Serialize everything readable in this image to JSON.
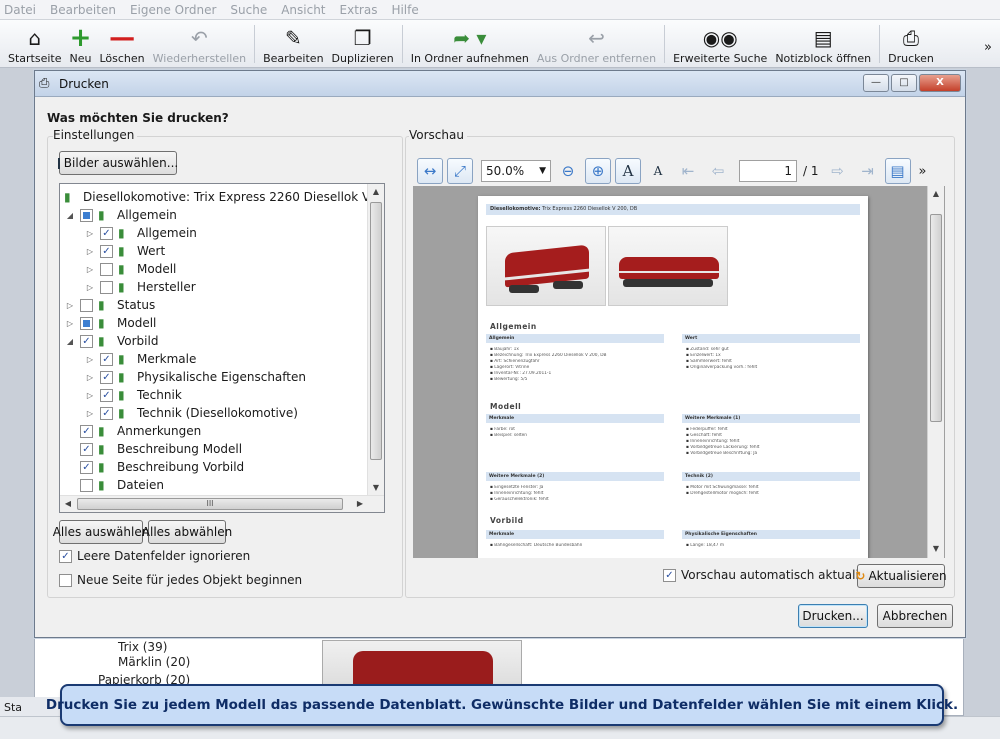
{
  "menubar": [
    "Datei",
    "Bearbeiten",
    "Eigene Ordner",
    "Suche",
    "Ansicht",
    "Extras",
    "Hilfe"
  ],
  "toolbar": {
    "startseite": "Startseite",
    "neu": "Neu",
    "loeschen": "Löschen",
    "wiederherstellen": "Wiederherstellen",
    "bearbeiten": "Bearbeiten",
    "duplizieren": "Duplizieren",
    "in_ordner": "In Ordner aufnehmen",
    "aus_ordner": "Aus Ordner entfernen",
    "erweiterte_suche": "Erweiterte Suche",
    "notizblock": "Notizblock öffnen",
    "drucken": "Drucken",
    "more": "»"
  },
  "background": {
    "item1": "Trix (39)",
    "item2": "Märklin (20)",
    "item3": "Papierkorb (20)",
    "status": "Sta"
  },
  "dialog": {
    "title": "Drucken",
    "question": "Was möchten Sie drucken?",
    "settings_label": "Einstellungen",
    "preview_label": "Vorschau",
    "select_images": "Bilder auswählen...",
    "select_all": "Alles auswählen",
    "deselect_all": "Alles abwählen",
    "ignore_empty": "Leere Datenfelder ignorieren",
    "new_page": "Neue Seite für jedes Objekt beginnen",
    "auto_update": "Vorschau automatisch aktualisieren",
    "refresh": "Aktualisieren",
    "print": "Drucken...",
    "cancel": "Abbrechen",
    "close": "X"
  },
  "tree": {
    "root": "Diesellokomotive: Trix Express 2260 Diesellok V 200, DB",
    "items": [
      {
        "label": "Allgemein",
        "level": 1,
        "state": "partial",
        "expander": "open"
      },
      {
        "label": "Allgemein",
        "level": 2,
        "state": "checked",
        "expander": "closed"
      },
      {
        "label": "Wert",
        "level": 2,
        "state": "checked",
        "expander": "closed"
      },
      {
        "label": "Modell",
        "level": 2,
        "state": "unchecked",
        "expander": "closed"
      },
      {
        "label": "Hersteller",
        "level": 2,
        "state": "unchecked",
        "expander": "closed"
      },
      {
        "label": "Status",
        "level": 1,
        "state": "unchecked",
        "expander": "closed"
      },
      {
        "label": "Modell",
        "level": 1,
        "state": "partial",
        "expander": "closed"
      },
      {
        "label": "Vorbild",
        "level": 1,
        "state": "checked",
        "expander": "open"
      },
      {
        "label": "Merkmale",
        "level": 2,
        "state": "checked",
        "expander": "closed"
      },
      {
        "label": "Physikalische Eigenschaften",
        "level": 2,
        "state": "checked",
        "expander": "closed"
      },
      {
        "label": "Technik",
        "level": 2,
        "state": "checked",
        "expander": "closed"
      },
      {
        "label": "Technik (Diesellokomotive)",
        "level": 2,
        "state": "checked",
        "expander": "closed"
      },
      {
        "label": "Anmerkungen",
        "level": 1,
        "state": "checked",
        "expander": "none"
      },
      {
        "label": "Beschreibung Modell",
        "level": 1,
        "state": "checked",
        "expander": "none"
      },
      {
        "label": "Beschreibung Vorbild",
        "level": 1,
        "state": "checked",
        "expander": "none"
      },
      {
        "label": "Dateien",
        "level": 1,
        "state": "unchecked",
        "expander": "none"
      }
    ],
    "hscroll_grip": "III"
  },
  "preview": {
    "zoom": "50.0%",
    "page_current": "1",
    "page_total": "/ 1",
    "more": "»",
    "page": {
      "header_bold": "Diesellokomotive:",
      "header_rest": "Trix Express 2260 Diesellok V 200, DB",
      "section_allgemein": "Allgemein",
      "section_modell": "Modell",
      "section_vorbild": "Vorbild",
      "col_allgemein": "Allgemein",
      "col_wert": "Wert",
      "col_merkmale": "Merkmale",
      "col_weitere1": "Weitere Merkmale (1)",
      "col_weitere2": "Weitere Merkmale (2)",
      "col_technik2": "Technik (2)",
      "col_vb_merkmale": "Merkmale",
      "col_vb_phys": "Physikalische Eigenschaften",
      "allgemein_lines": [
        "Baujahr: 1x",
        "Bezeichnung: Trix Express 2260 Diesellok V 200, DB",
        "Art: Schienenzugfahr",
        "Lagerort: Vitrine",
        "Inventar-Nr.: 27.09.2011-1",
        "Bewertung: 5/5"
      ],
      "wert_lines": [
        "Zustand: sehr gut",
        "Einzelwert: 1x",
        "Sammlerwert: fehlt",
        "Originalverpackung vorh.: fehlt"
      ],
      "merkmale_lines": [
        "Farbe: rot",
        "Beispiel: selten"
      ],
      "weitere1_lines": [
        "Federpuffer: fehlt",
        "Geschäft: fehlt",
        "Inneneinrichtung: fehlt",
        "Vorbildgetreue Lackierung: fehlt",
        "Vorbildgetreue Beschriftung: Ja"
      ],
      "weitere2_lines": [
        "Eingesetzte Fenster: Ja",
        "Inneneinrichtung: fehlt",
        "Geräuschelektronik: fehlt"
      ],
      "technik2_lines": [
        "Motor mit Schwungmasse: fehlt",
        "Drehgestellmotor möglich: fehlt"
      ],
      "vb_merkmale_lines": [
        "Bahngesellschaft: Deutsche Bundesbahn"
      ],
      "vb_phys_lines": [
        "Länge: 18,47 m"
      ]
    }
  },
  "caption": "Drucken Sie zu jedem Modell das passende Datenblatt. Gewünschte Bilder und Datenfelder wählen Sie mit einem Klick.",
  "colors": {
    "caption_bg": "#c7dcf7",
    "caption_border": "#1a3a73",
    "locomotive_red": "#a51d1d"
  }
}
